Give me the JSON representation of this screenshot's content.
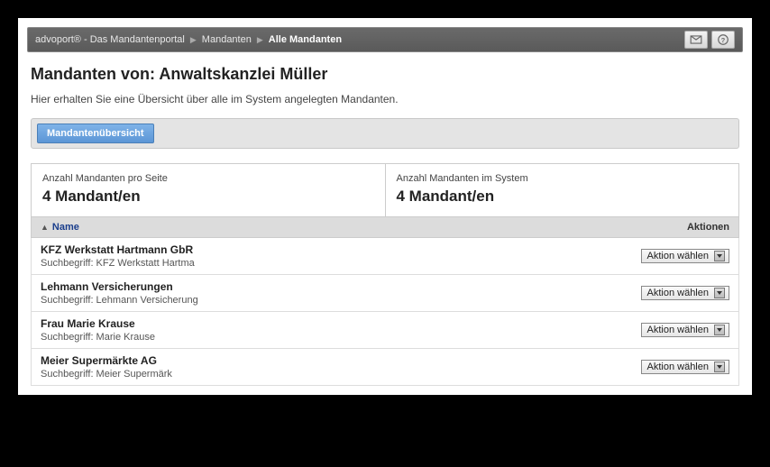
{
  "breadcrumb": {
    "root": "advoport® - Das Mandantenportal",
    "mid": "Mandanten",
    "current": "Alle Mandanten"
  },
  "page": {
    "title": "Mandanten von: Anwaltskanzlei Müller",
    "subtitle": "Hier erhalten Sie eine Übersicht über alle im System angelegten Mandanten."
  },
  "tabs": {
    "overview": "Mandantenübersicht"
  },
  "stats": {
    "per_page_label": "Anzahl Mandanten pro Seite",
    "per_page_value": "4 Mandant/en",
    "total_label": "Anzahl Mandanten im System",
    "total_value": "4 Mandant/en"
  },
  "table": {
    "col_name": "Name",
    "col_actions": "Aktionen",
    "action_placeholder": "Aktion wählen",
    "search_prefix": "Suchbegriff: ",
    "rows": [
      {
        "name": "KFZ Werkstatt Hartmann GbR",
        "search": "KFZ Werkstatt Hartma"
      },
      {
        "name": "Lehmann Versicherungen",
        "search": "Lehmann Versicherung"
      },
      {
        "name": "Frau Marie Krause",
        "search": "Marie Krause"
      },
      {
        "name": "Meier Supermärkte AG",
        "search": "Meier Supermärk"
      }
    ]
  }
}
